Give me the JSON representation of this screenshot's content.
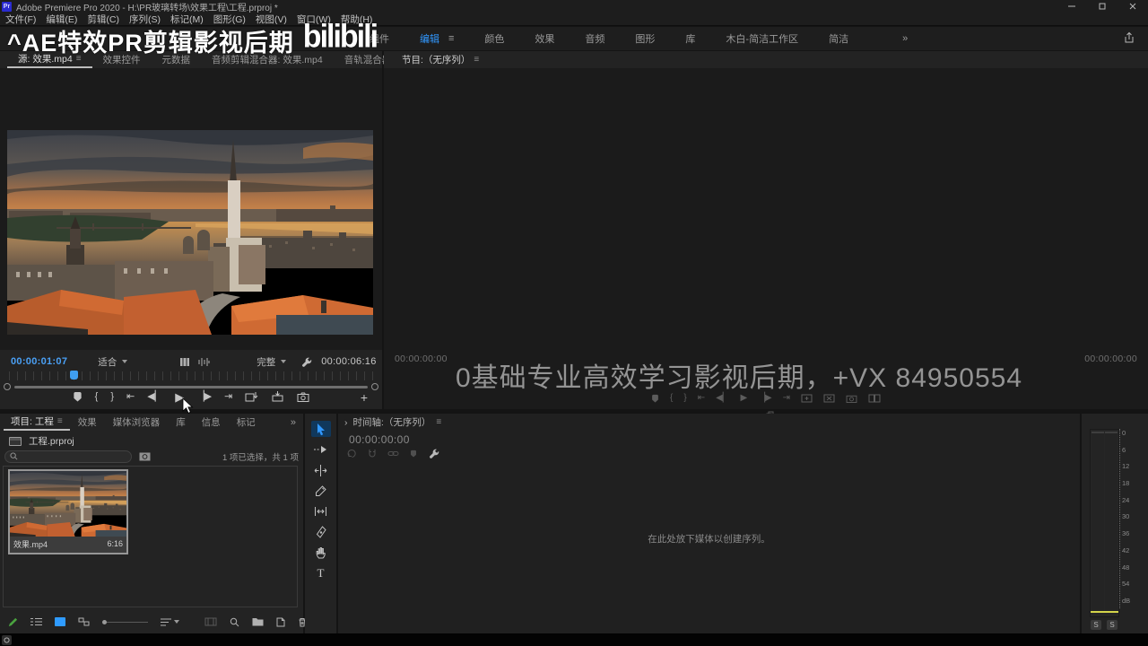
{
  "titlebar": {
    "app_badge": "Pr",
    "title": "Adobe Premiere Pro 2020 - H:\\PR玻璃转场\\效果工程\\工程.prproj *"
  },
  "menu_items": [
    "文件(F)",
    "编辑(E)",
    "剪辑(C)",
    "序列(S)",
    "标记(M)",
    "图形(G)",
    "视图(V)",
    "窗口(W)",
    "帮助(H)"
  ],
  "workspace_tabs": [
    "组件",
    "编辑",
    "颜色",
    "效果",
    "音频",
    "图形",
    "库",
    "木白-简洁工作区",
    "简洁"
  ],
  "glyphs": {
    "hamburger": "≡",
    "overflow": "»",
    "chevron": "›"
  },
  "watermark_top": {
    "text": "^AE特效PR剪辑影视后期",
    "logo": "bilibili"
  },
  "transport": {
    "mark_in": "{",
    "mark_out": "}",
    "go_in": "⇤",
    "step_back": "◀▏",
    "play": "▶",
    "step_fwd": "▕▶",
    "go_out": "⇥",
    "plus": "+"
  },
  "source_monitor": {
    "tab_active": "源: 效果.mp4",
    "tabs": [
      "效果控件",
      "元数据",
      "音频剪辑混合器: 效果.mp4",
      "音轨混合器:（无"
    ],
    "timecode": "00:00:01:07",
    "zoom_level": "适合",
    "resolution": "完整",
    "duration": "00:00:06:16"
  },
  "program_monitor": {
    "title": "节目:（无序列）",
    "timecode_left": "00:00:00:00",
    "timecode_right": "00:00:00:00",
    "watermark": "0基础专业高效学习影视后期，+VX  84950554"
  },
  "project_panel": {
    "tab_active": "项目: 工程",
    "tabs": [
      "效果",
      "媒体浏览器",
      "库",
      "信息",
      "标记"
    ],
    "project_file": "工程.prproj",
    "selection_status": "1 项已选择，共 1 项",
    "clip_name": "效果.mp4",
    "clip_duration": "6:16"
  },
  "tools": {
    "type_label": "T"
  },
  "timeline": {
    "title": "时间轴:（无序列）",
    "timecode": "00:00:00:00",
    "empty_message": "在此处放下媒体以创建序列。"
  },
  "audio_meter": {
    "scale": [
      "0",
      "6",
      "12",
      "18",
      "24",
      "30",
      "36",
      "42",
      "48",
      "54",
      "dB"
    ],
    "solo_left": "S",
    "solo_right": "S"
  }
}
